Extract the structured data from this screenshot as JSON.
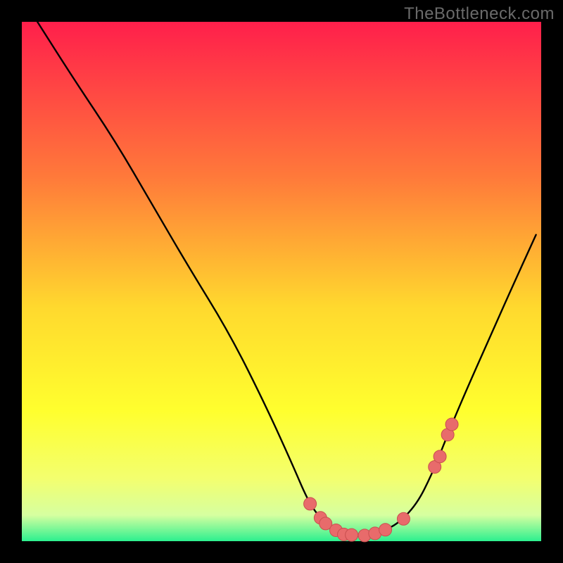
{
  "watermark": "TheBottleneck.com",
  "colors": {
    "frame": "#000000",
    "gradient_top": "#ff1f4b",
    "gradient_mid1": "#ff7a3a",
    "gradient_mid2": "#ffd92e",
    "gradient_mid3": "#ffff2e",
    "gradient_mid4": "#f3ff6f",
    "gradient_mid5": "#d6ffa0",
    "gradient_bottom": "#2cf08f",
    "curve": "#000000",
    "marker_fill": "#e86b6b",
    "marker_stroke": "#c94f4f"
  },
  "chart_data": {
    "type": "line",
    "title": "",
    "xlabel": "",
    "ylabel": "",
    "xlim": [
      0,
      100
    ],
    "ylim": [
      0,
      100
    ],
    "series": [
      {
        "name": "bottleneck-curve",
        "x": [
          3,
          10,
          18,
          25,
          32,
          40,
          47,
          52,
          55,
          57,
          59,
          61,
          62,
          63,
          65,
          67,
          69,
          72,
          76,
          79,
          81,
          83,
          86,
          90,
          94,
          99
        ],
        "y": [
          100,
          89,
          77,
          65,
          53,
          40,
          26,
          15,
          8,
          5,
          3,
          2,
          1,
          1,
          1,
          1,
          2,
          3,
          7,
          13,
          18,
          23,
          30,
          39,
          48,
          59
        ]
      }
    ],
    "markers": {
      "name": "highlight-points",
      "x": [
        55.5,
        57.5,
        58.5,
        60.5,
        62.0,
        63.5,
        66.0,
        68.0,
        70.0,
        73.5,
        79.5,
        80.5,
        82.0,
        82.8
      ],
      "y": [
        7.2,
        4.5,
        3.4,
        2.1,
        1.3,
        1.2,
        1.1,
        1.5,
        2.2,
        4.3,
        14.3,
        16.3,
        20.5,
        22.5
      ]
    }
  }
}
